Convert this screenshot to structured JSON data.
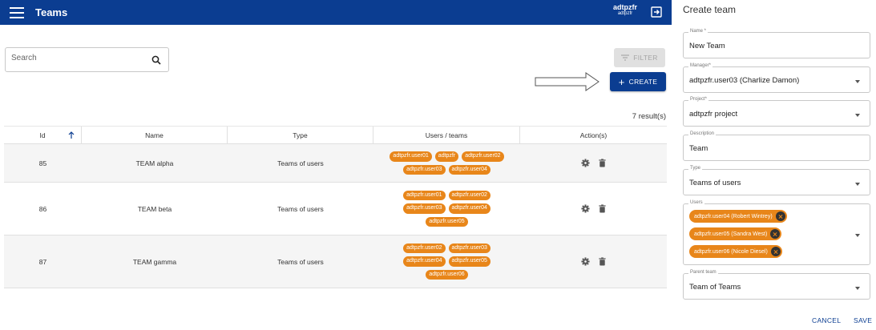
{
  "header": {
    "title": "Teams",
    "user_name": "adtpzfr",
    "user_sub": "adtpzfr"
  },
  "search": {
    "placeholder": "Search"
  },
  "toolbar": {
    "filter_label": "FILTER",
    "create_label": "CREATE",
    "results": "7 result(s)"
  },
  "table": {
    "columns": [
      "Id",
      "Name",
      "Type",
      "Users / teams",
      "Action(s)"
    ],
    "rows": [
      {
        "id": "85",
        "name": "TEAM alpha",
        "type": "Teams of users",
        "users": [
          "adtpzfr.user01",
          "adtpzfr",
          "adtpzfr.user02",
          "adtpzfr.user03",
          "adtpzfr.user04"
        ]
      },
      {
        "id": "86",
        "name": "TEAM beta",
        "type": "Teams of users",
        "users": [
          "adtpzfr.user01",
          "adtpzfr.user02",
          "adtpzfr.user03",
          "adtpzfr.user04",
          "adtpzfr.user05"
        ]
      },
      {
        "id": "87",
        "name": "TEAM gamma",
        "type": "Teams of users",
        "users": [
          "adtpzfr.user02",
          "adtpzfr.user03",
          "adtpzfr.user04",
          "adtpzfr.user05",
          "adtpzfr.user06"
        ]
      }
    ]
  },
  "panel": {
    "title": "Create team",
    "name": {
      "label": "Name *",
      "value": "New Team"
    },
    "manager": {
      "label": "Manager*",
      "value": "adtpzfr.user03 (Charlize Damon)"
    },
    "project": {
      "label": "Project*",
      "value": "adtpzfr project"
    },
    "description": {
      "label": "Description",
      "value": "Team"
    },
    "type": {
      "label": "Type",
      "value": "Teams of users"
    },
    "users": {
      "label": "Users",
      "chips": [
        "adtpzfr.user04 (Robert Wintrey)",
        "adtpzfr.user05 (Sandra West)",
        "adtpzfr.user06 (Nicole Diesel)"
      ]
    },
    "parent": {
      "label": "Parent team",
      "value": "Team of Teams"
    },
    "cancel_label": "CANCEL",
    "save_label": "SAVE"
  },
  "colors": {
    "primary": "#0b3d91",
    "chip": "#e8861a"
  }
}
